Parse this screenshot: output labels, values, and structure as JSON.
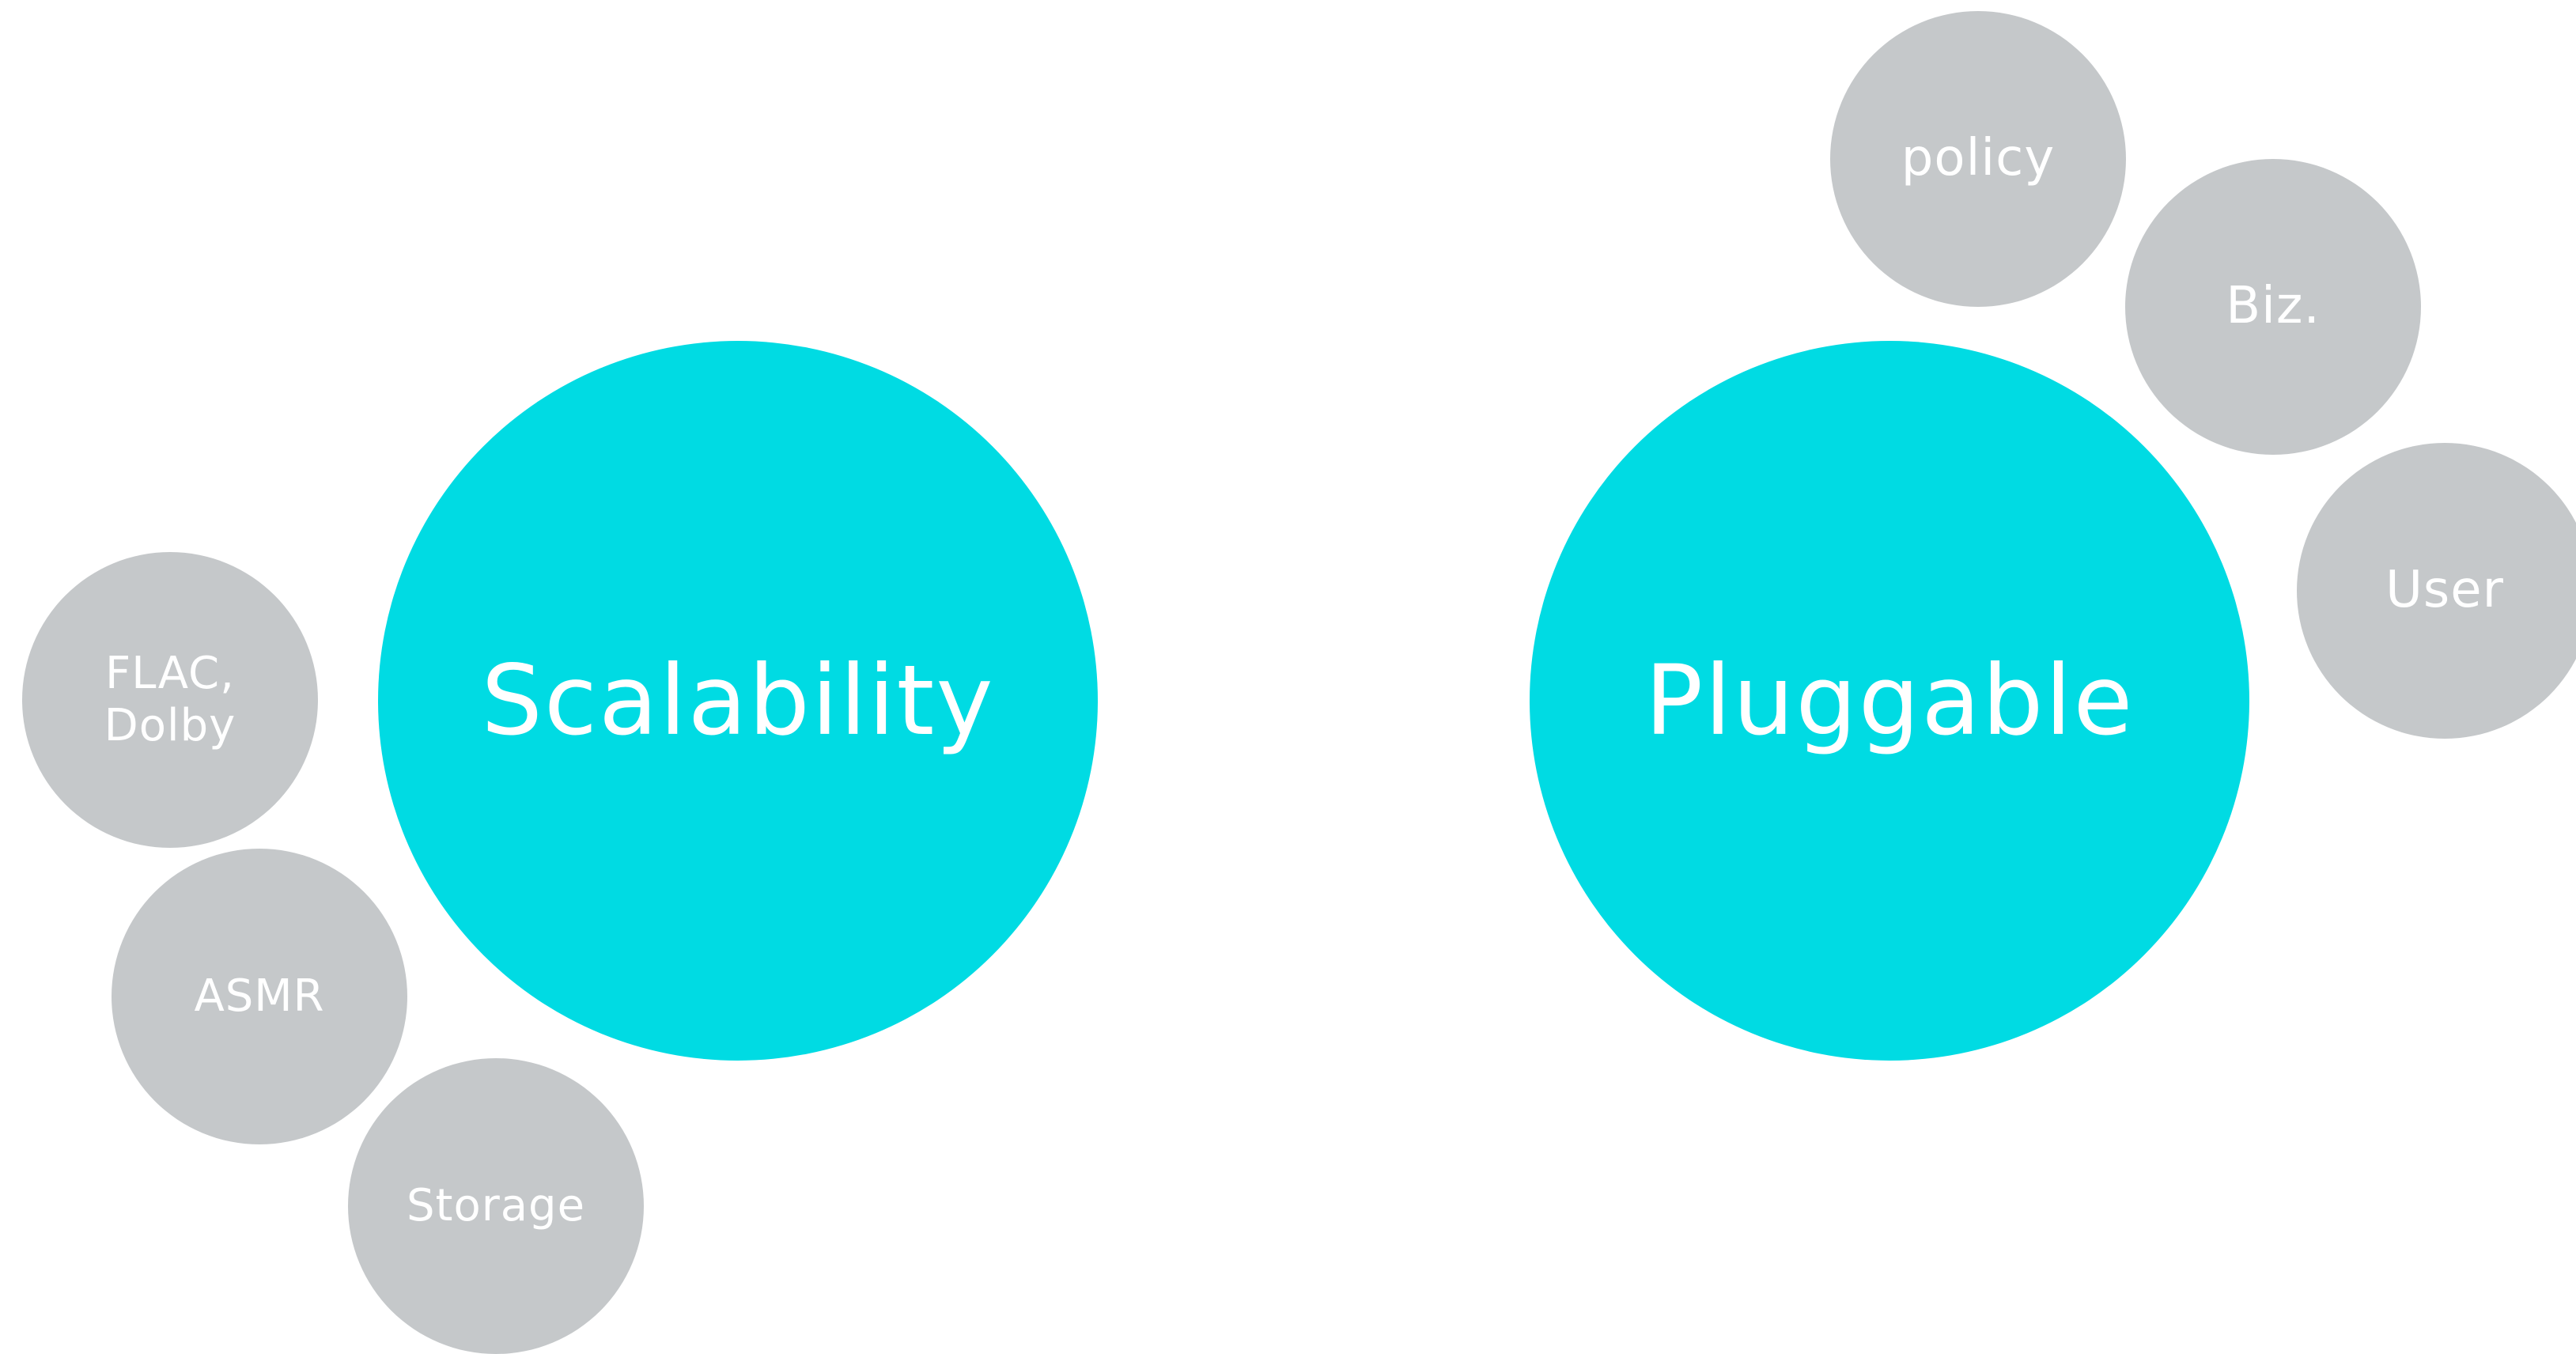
{
  "diagram": {
    "colors": {
      "main_circle": "#00dbe3",
      "sub_circle": "#c5c8ca",
      "text": "#ffffff",
      "background": "#ffffff"
    },
    "clusters": [
      {
        "main": "Scalability",
        "satellites": [
          "FLAC,\nDolby",
          "ASMR",
          "Storage"
        ]
      },
      {
        "main": "Pluggable",
        "satellites": [
          "policy",
          "Biz.",
          "User"
        ]
      }
    ]
  }
}
